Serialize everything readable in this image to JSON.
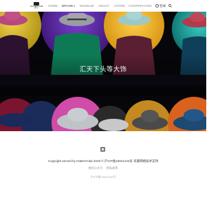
{
  "header": {
    "logo_text": "HATTERS'HUB",
    "logo_subtext": "帽子汇",
    "nav": [
      {
        "label": "HOME",
        "active": false
      },
      {
        "label": "BRAND",
        "active": true,
        "has_dropdown": true
      },
      {
        "label": "MUSEUM",
        "active": false
      },
      {
        "label": "ABOUT",
        "active": false
      },
      {
        "label": "STORE",
        "active": false
      },
      {
        "label": "COOPERATION",
        "active": false
      }
    ],
    "login_label": "登录",
    "search_icon": "search-icon"
  },
  "hero": {
    "title": "汇天下头等大饰"
  },
  "footer": {
    "copyright": "Copyright served by Hatters'Hub 2019 © 沪ICP备18041444号 讯嘉网络技术支持",
    "links": [
      "微信公众号",
      "隐私政策"
    ],
    "icp": "沪ICP备18041444号"
  },
  "colors": {
    "hero_bg": "#07060a",
    "hero_text": "#f2f2f2",
    "nav_text": "#8a8a8a",
    "footer_text": "#3a3a3a"
  }
}
